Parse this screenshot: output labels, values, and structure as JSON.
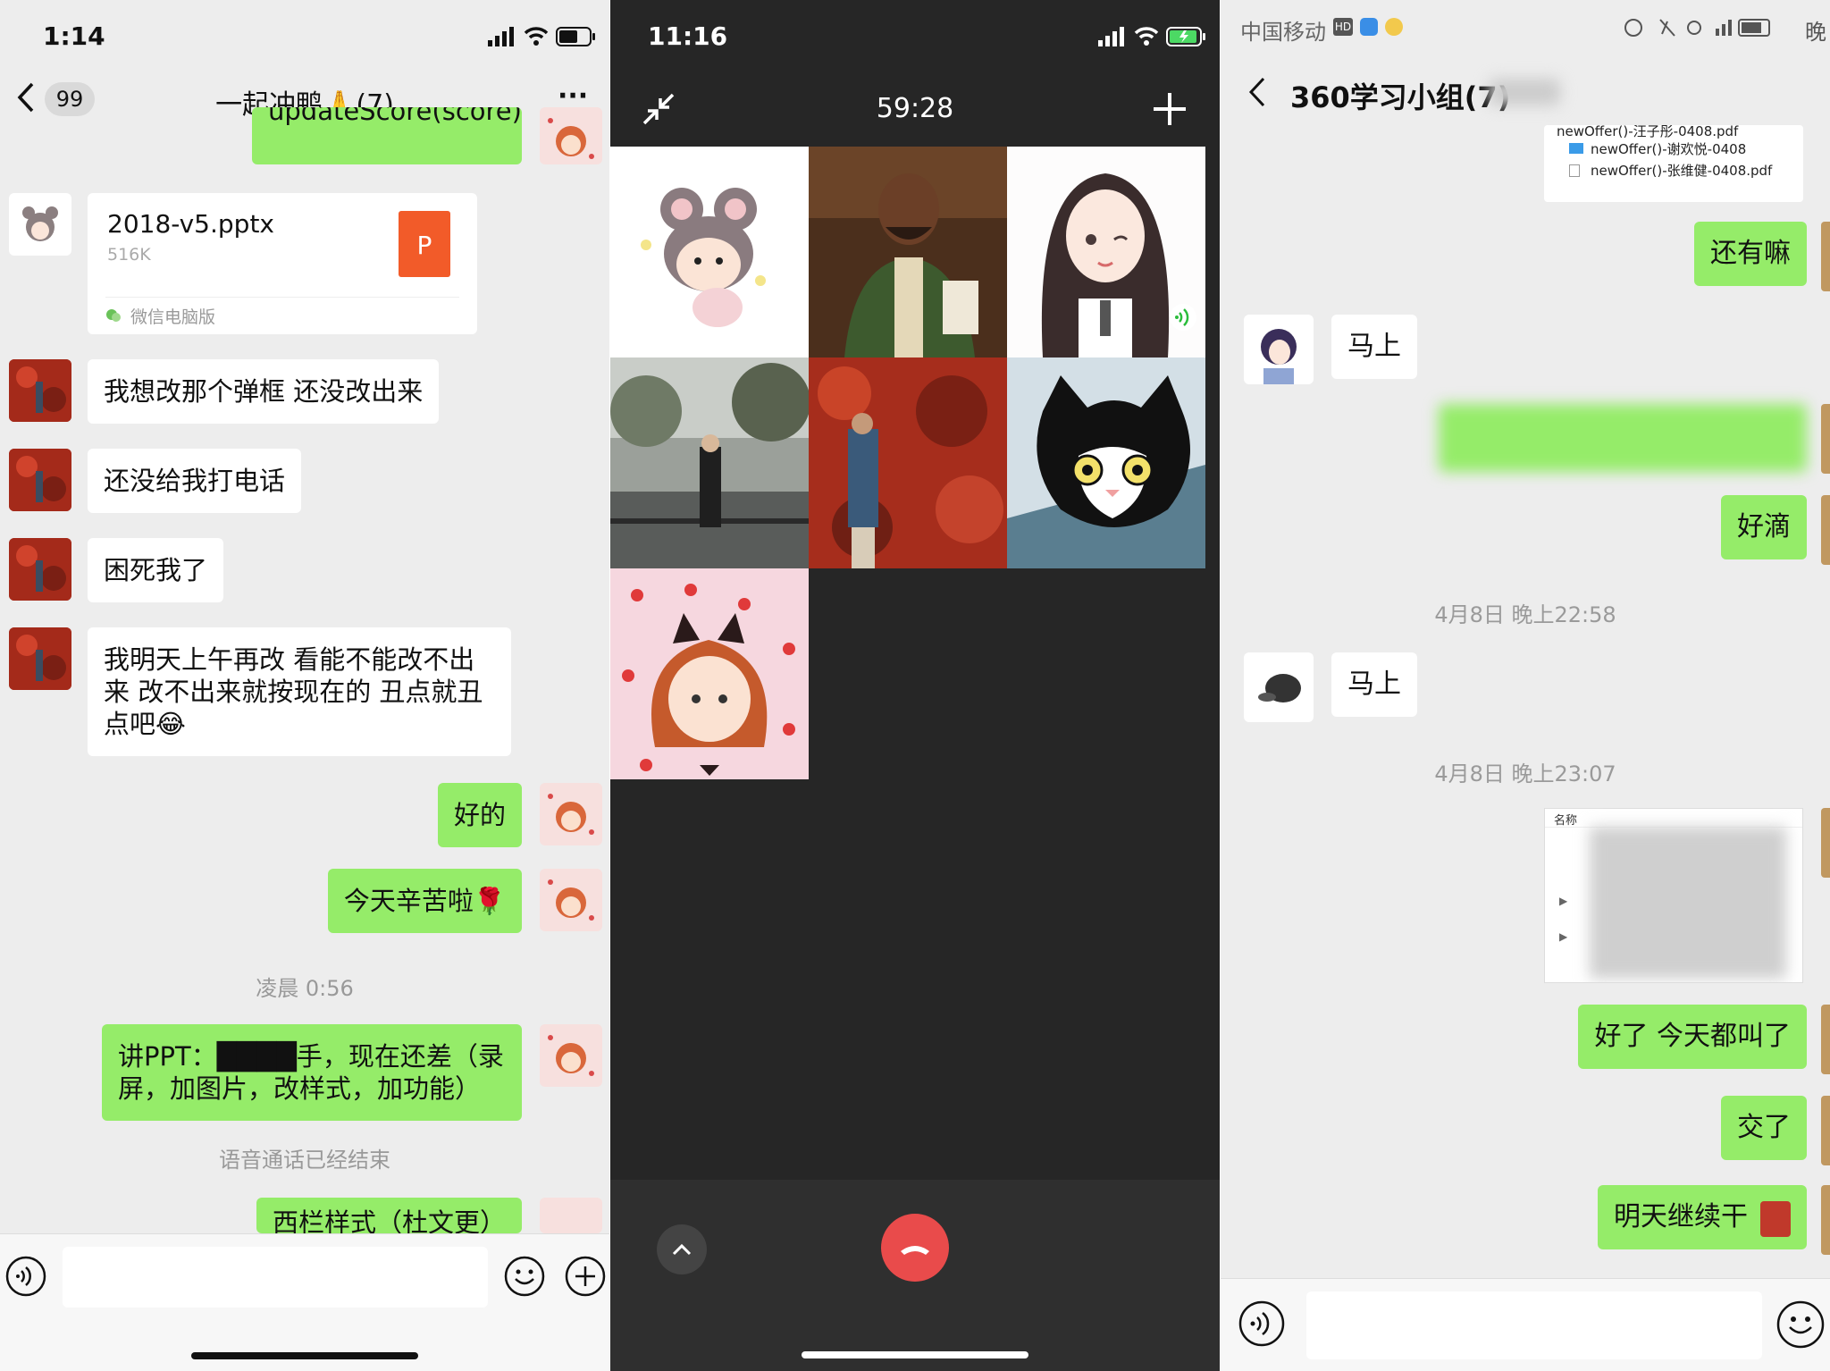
{
  "left": {
    "status": {
      "time": "1:14"
    },
    "nav": {
      "back_count": "99",
      "title": "一起冲鸭🙏(7)",
      "more": "···"
    },
    "messages": {
      "top_partial": "updateScore(score)",
      "file": {
        "name": "2018-v5.pptx",
        "size": "516K",
        "badge": "P",
        "source": "微信电脑版"
      },
      "m1": "我想改那个弹框 还没改出来",
      "m2": "还没给我打电话",
      "m3": "困死我了",
      "m4": "我明天上午再改 看能不能改不出来 改不出来就按现在的 丑点就丑点吧😂",
      "m5": "好的",
      "m6": "今天辛苦啦🌹",
      "time1": "凌晨 0:56",
      "m7": "讲PPT：████手，现在还差（录屏，加图片，改样式，加功能）",
      "system": "语音通话已经结束",
      "bottom_partial": "西栏样式（杜文更）"
    }
  },
  "middle": {
    "status": {
      "time": "11:16"
    },
    "timer": "59:28",
    "tiles": [
      "mouse-girl-avatar",
      "bearded-man-avatar",
      "anime-girl-avatar",
      "girl-by-river-photo",
      "girl-red-leaves-photo",
      "cat-cartoon-avatar",
      "strawberry-girl-avatar"
    ]
  },
  "right": {
    "status": {
      "carrier": "中国移动",
      "hd": "HD",
      "right_text": "晚"
    },
    "nav": {
      "title": "360学习小组(7)"
    },
    "file_card": {
      "line0": "newOffer()-汪子彤-0408.pdf",
      "line1": "newOffer()-谢欢悦-0408",
      "line2": "newOffer()-张维健-0408.pdf"
    },
    "messages": {
      "r1": "还有嘛",
      "r2": "马上",
      "r3": "████████████████",
      "r4": "好滴",
      "time1": "4月8日 晚上22:58",
      "r5": "马上",
      "time2": "4月8日 晚上23:07",
      "shot_header": "名称",
      "r6": "好了 今天都叫了",
      "r7": "交了",
      "r8": "明天继续干"
    }
  },
  "colors": {
    "green_bubble": "#95ec69",
    "bg_chat": "#ededed",
    "call_bg": "#262626",
    "hangup": "#e94b4b"
  }
}
